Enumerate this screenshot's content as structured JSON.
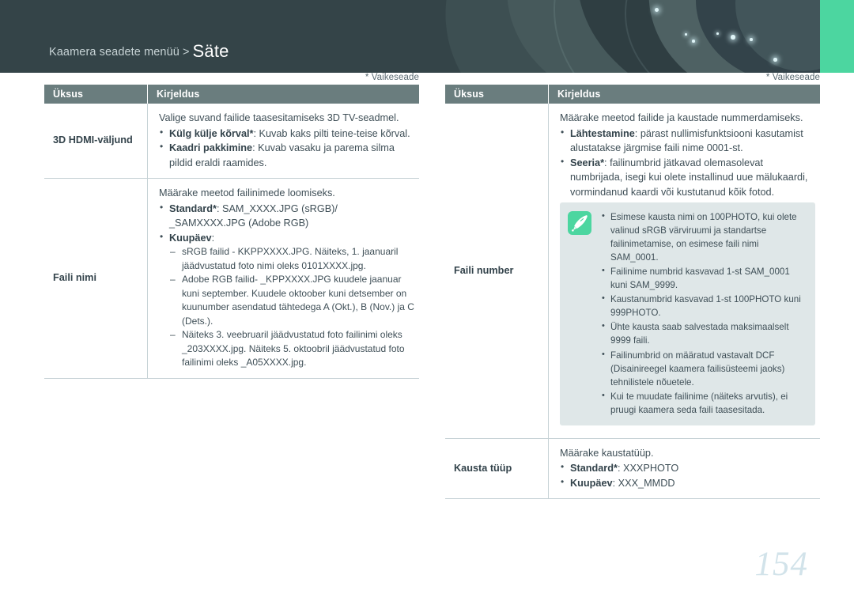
{
  "header": {
    "breadcrumb_prefix": "Kaamera seadete menüü",
    "breadcrumb_separator": ">",
    "breadcrumb_title": "Säte",
    "accent_color": "#4cd6a0",
    "background_color": "#344448"
  },
  "page": {
    "page_number": "154"
  },
  "left_column": {
    "default_note": "* Vaikeseade",
    "columns": {
      "item": "Üksus",
      "description": "Kirjeldus"
    },
    "rows": [
      {
        "item": "3D HDMI-väljund",
        "lead": "Valige suvand failide taasesitamiseks 3D TV-seadmel.",
        "bullets": [
          {
            "bold": "Külg külje kõrval*",
            "rest": ": Kuvab kaks pilti teine-teise kõrval."
          },
          {
            "bold": "Kaadri pakkimine",
            "rest": ": Kuvab vasaku ja parema silma pildid eraldi raamides."
          }
        ]
      },
      {
        "item": "Faili nimi",
        "lead": "Määrake meetod failinimede loomiseks.",
        "bullets": [
          {
            "bold": "Standard*",
            "rest": ": SAM_XXXX.JPG (sRGB)/ _SAMXXXX.JPG (Adobe RGB)"
          },
          {
            "bold": "Kuupäev",
            "rest": ":"
          }
        ],
        "dashes": [
          "sRGB failid - KKPPXXXX.JPG. Näiteks, 1. jaanuaril jäädvustatud foto nimi oleks 0101XXXX.jpg.",
          "Adobe RGB failid- _KPPXXXX.JPG kuudele jaanuar kuni september. Kuudele oktoober kuni detsember on kuunumber asendatud tähtedega A (Okt.), B (Nov.) ja C (Dets.)."
        ],
        "tail": "Näiteks 3. veebruaril jäädvustatud foto failinimi oleks _203XXXX.jpg. Näiteks 5. oktoobril jäädvustatud foto failinimi oleks _A05XXXX.jpg."
      }
    ]
  },
  "right_column": {
    "default_note": "* Vaikeseade",
    "columns": {
      "item": "Üksus",
      "description": "Kirjeldus"
    },
    "rows": [
      {
        "item": "Faili number",
        "lead": "Määrake meetod failide ja kaustade nummerdamiseks.",
        "bullets": [
          {
            "bold": "Lähtestamine",
            "rest": ": pärast nullimisfunktsiooni kasutamist alustatakse järgmise faili nime 0001-st."
          },
          {
            "bold": "Seeria*",
            "rest": ": failinumbrid jätkavad olemasolevat numbrijada, isegi kui olete installinud uue mälukaardi, vormindanud kaardi või kustutanud kõik fotod."
          }
        ],
        "infobox": {
          "icon": "quill-pen-icon",
          "icon_background": "#4cd6a0",
          "background": "#dfe7e8",
          "notes": [
            "Esimese kausta nimi on 100PHOTO, kui olete valinud sRGB värviruumi ja standartse failinimetamise, on esimese faili nimi SAM_0001.",
            "Failinime numbrid kasvavad 1-st SAM_0001 kuni SAM_9999.",
            "Kaustanumbrid kasvavad 1-st 100PHOTO kuni 999PHOTO.",
            "Ühte kausta saab salvestada maksimaalselt 9999 faili.",
            "Failinumbrid on määratud vastavalt DCF (Disainireegel kaamera failisüsteemi jaoks) tehnilistele nõuetele.",
            "Kui te muudate failinime (näiteks arvutis), ei pruugi kaamera seda faili taasesitada."
          ]
        }
      },
      {
        "item": "Kausta tüüp",
        "lead": "Määrake kaustatüüp.",
        "bullets": [
          {
            "bold": "Standard*",
            "rest": ": XXXPHOTO"
          },
          {
            "bold": "Kuupäev",
            "rest": ": XXX_MMDD"
          }
        ]
      }
    ]
  }
}
